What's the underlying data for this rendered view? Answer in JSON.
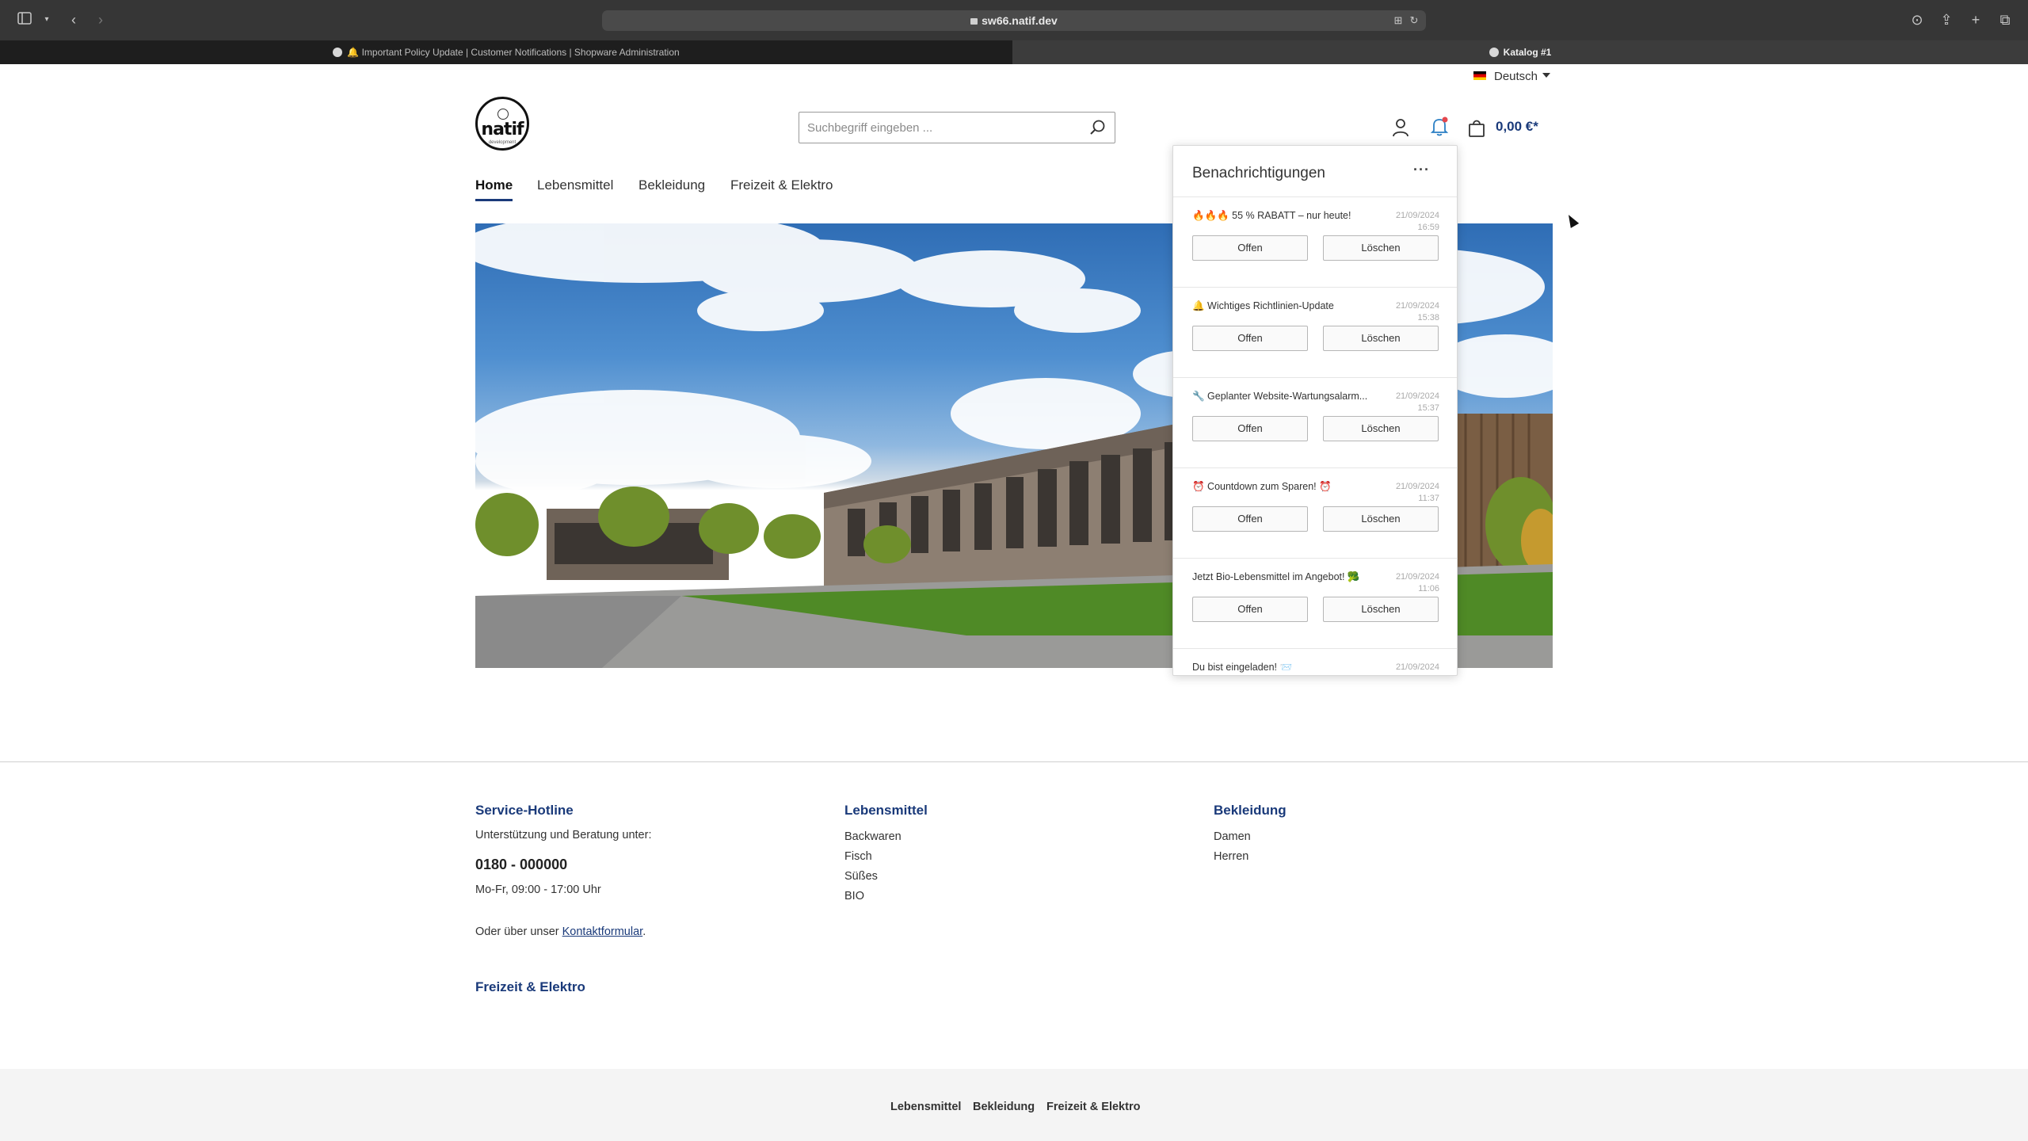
{
  "browser": {
    "url": "sw66.natif.dev",
    "tabs": [
      {
        "label": "🔔 Important Policy Update | Customer Notifications | Shopware Administration",
        "active": false
      },
      {
        "label": "Katalog #1",
        "active": true
      }
    ]
  },
  "header": {
    "language": "Deutsch",
    "logo_text": "natif",
    "logo_sub": "development",
    "search_placeholder": "Suchbegriff eingeben ...",
    "cart_total": "0,00 €*"
  },
  "nav": {
    "items": [
      {
        "label": "Home",
        "active": true
      },
      {
        "label": "Lebensmittel",
        "active": false
      },
      {
        "label": "Bekleidung",
        "active": false
      },
      {
        "label": "Freizeit & Elektro",
        "active": false
      }
    ]
  },
  "notifications": {
    "title": "Benachrichtigungen",
    "more": "···",
    "open_label": "Offen",
    "delete_label": "Löschen",
    "items": [
      {
        "title": "🔥🔥🔥 55 % RABATT – nur heute!",
        "date": "21/09/2024",
        "time": "16:59"
      },
      {
        "title": "🔔 Wichtiges Richtlinien-Update",
        "date": "21/09/2024",
        "time": "15:38"
      },
      {
        "title": "🔧 Geplanter Website-Wartungsalarm...",
        "date": "21/09/2024",
        "time": "15:37"
      },
      {
        "title": "⏰ Countdown zum Sparen! ⏰",
        "date": "21/09/2024",
        "time": "11:37"
      },
      {
        "title": "Jetzt Bio-Lebensmittel im Angebot! 🥦",
        "date": "21/09/2024",
        "time": "11:06"
      },
      {
        "title": "Du bist eingeladen! 📨",
        "date": "21/09/2024",
        "time": ""
      }
    ]
  },
  "footer": {
    "service": {
      "heading": "Service-Hotline",
      "intro": "Unterstützung und Beratung unter:",
      "phone": "0180 - 000000",
      "hours": "Mo-Fr, 09:00 - 17:00 Uhr",
      "contact_prefix": "Oder über unser",
      "contact_link": "Kontaktformular",
      "contact_suffix": "."
    },
    "col_lebensmittel": {
      "heading": "Lebensmittel",
      "items": [
        "Backwaren",
        "Fisch",
        "Süßes",
        "BIO"
      ]
    },
    "col_bekleidung": {
      "heading": "Bekleidung",
      "items": [
        "Damen",
        "Herren"
      ]
    },
    "col_freizeit": {
      "heading": "Freizeit & Elektro"
    },
    "bottom_links": [
      "Lebensmittel",
      "Bekleidung",
      "Freizeit & Elektro"
    ]
  },
  "colors": {
    "accent": "#1a3a7a",
    "notification_dot": "#e5484d"
  }
}
